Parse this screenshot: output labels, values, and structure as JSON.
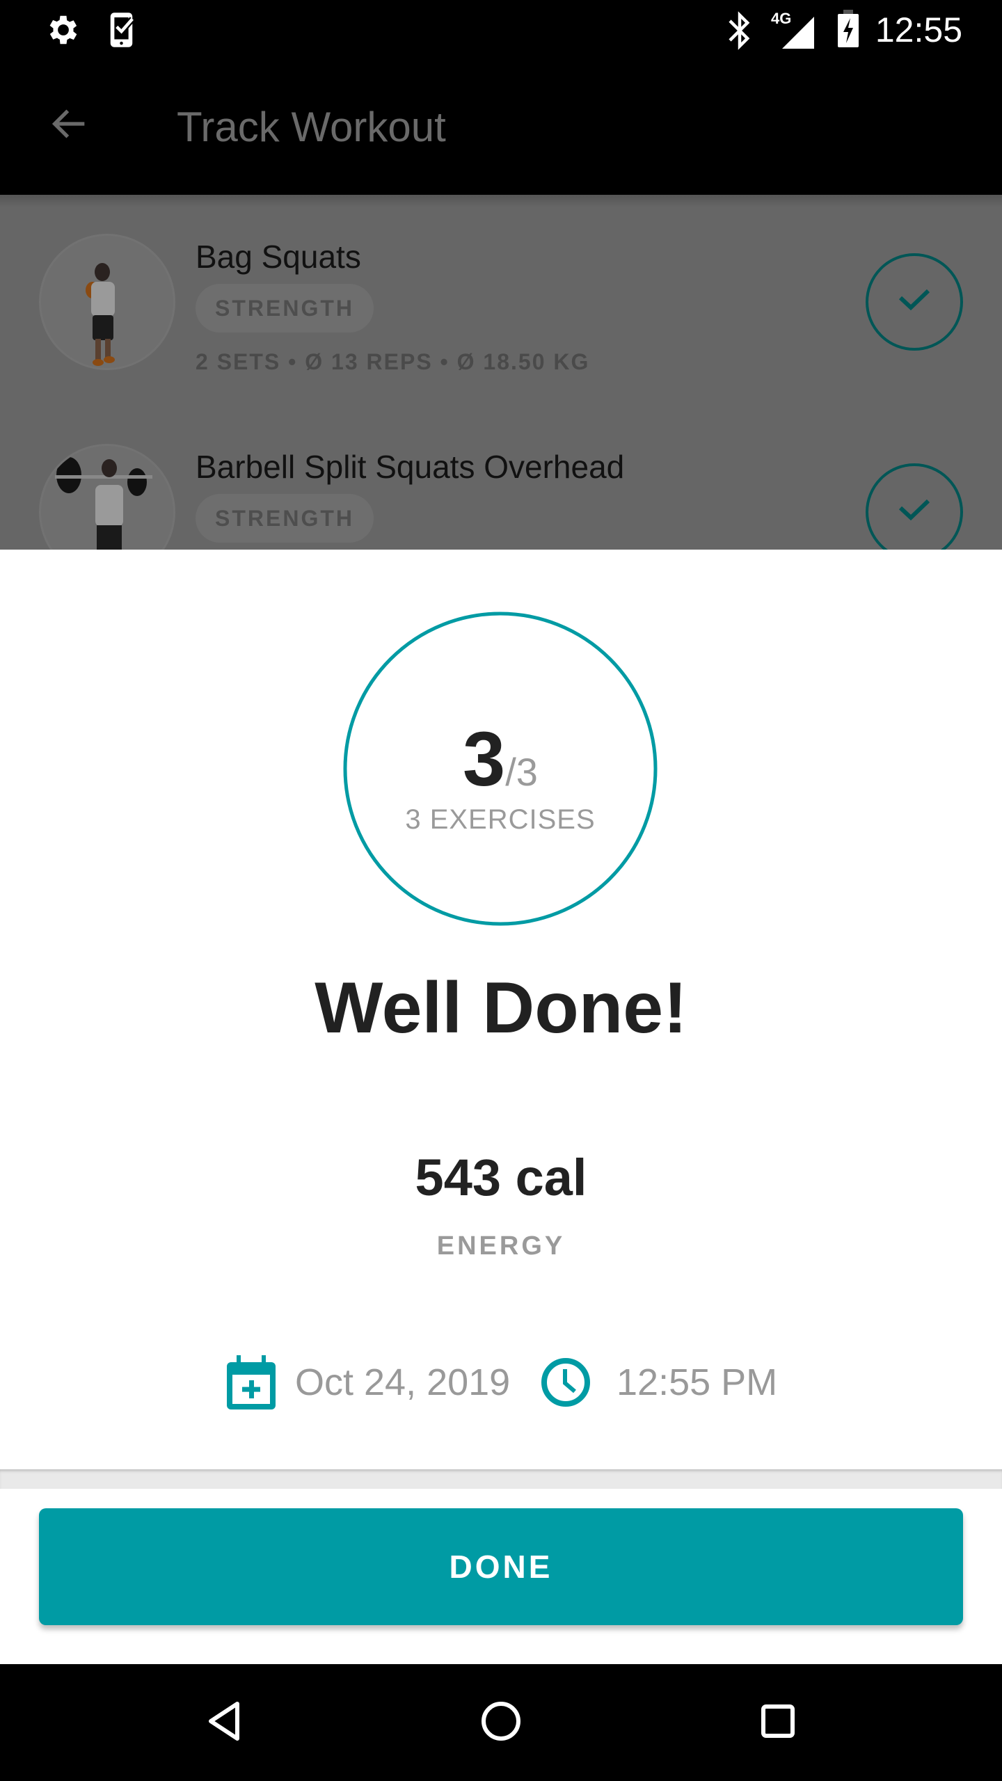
{
  "status_bar": {
    "time": "12:55",
    "network": "4G",
    "icons": [
      "settings-icon",
      "device-check-icon",
      "bluetooth-icon",
      "signal-icon",
      "battery-charging-icon"
    ]
  },
  "app_bar": {
    "title": "Track Workout",
    "back_icon": "arrow-back-icon"
  },
  "exercises": [
    {
      "name": "Bag Squats",
      "category": "STRENGTH",
      "meta": "2 SETS • Ø 13 REPS  • Ø 18.50 KG",
      "completed": true
    },
    {
      "name": "Barbell Split Squats Overhead",
      "category": "STRENGTH",
      "completed": true
    }
  ],
  "summary": {
    "completed": "3",
    "total": "/3",
    "progress_fraction": 1.0,
    "exercises_label": "3 EXERCISES",
    "headline": "Well Done!",
    "energy_value": "543 cal",
    "energy_label": "ENERGY",
    "date": "Oct 24, 2019",
    "time": "12:55 PM"
  },
  "actions": {
    "done_label": "DONE"
  },
  "colors": {
    "accent": "#009BA4",
    "dimmed_accent": "#005656"
  },
  "nav_bar": {
    "items": [
      "back-nav-icon",
      "home-nav-icon",
      "recents-nav-icon"
    ]
  }
}
